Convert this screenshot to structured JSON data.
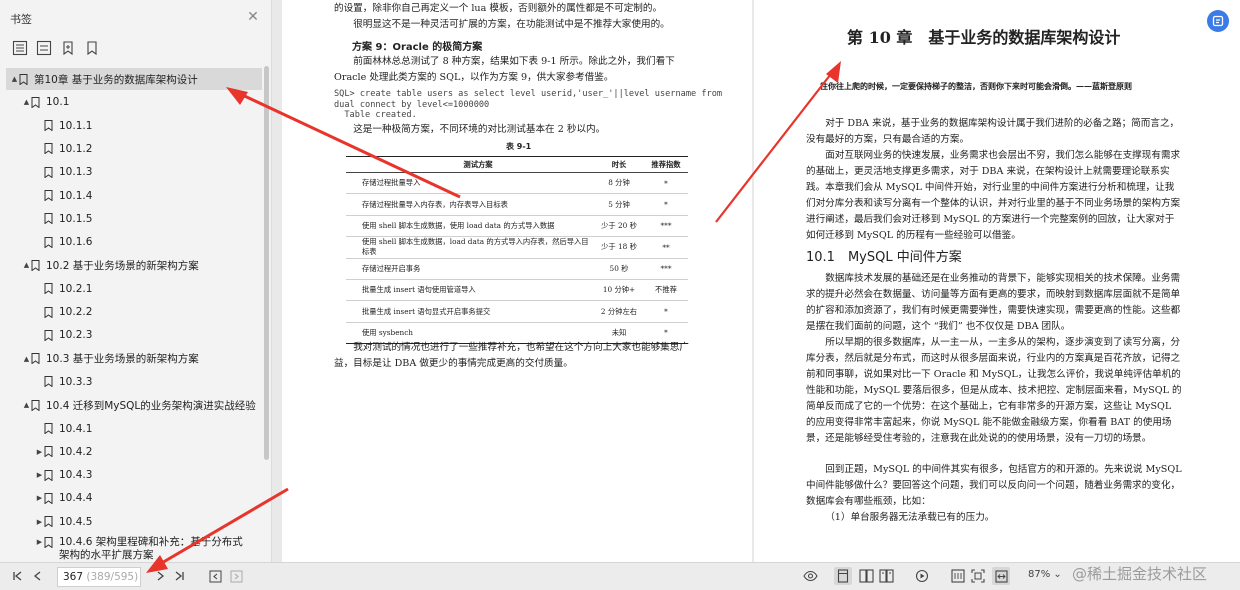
{
  "sidebar": {
    "title": "书签",
    "tools": [
      "expand-all-icon",
      "collapse-all-icon",
      "add-bookmark-icon",
      "bookmark-icon"
    ],
    "items": [
      {
        "label": "第10章 基于业务的数据库架构设计",
        "level": 1,
        "toggle": "▲",
        "selected": true
      },
      {
        "label": "10.1",
        "level": 2,
        "toggle": "▲"
      },
      {
        "label": "10.1.1",
        "level": 3,
        "toggle": ""
      },
      {
        "label": "10.1.2",
        "level": 3,
        "toggle": ""
      },
      {
        "label": "10.1.3",
        "level": 3,
        "toggle": ""
      },
      {
        "label": "10.1.4",
        "level": 3,
        "toggle": ""
      },
      {
        "label": "10.1.5",
        "level": 3,
        "toggle": ""
      },
      {
        "label": "10.1.6",
        "level": 3,
        "toggle": ""
      },
      {
        "label": "10.2 基于业务场景的新架构方案",
        "level": 2,
        "toggle": "▲"
      },
      {
        "label": "10.2.1",
        "level": 3,
        "toggle": ""
      },
      {
        "label": "10.2.2",
        "level": 3,
        "toggle": ""
      },
      {
        "label": "10.2.3",
        "level": 3,
        "toggle": ""
      },
      {
        "label": "10.3 基于业务场景的新架构方案",
        "level": 2,
        "toggle": "▲"
      },
      {
        "label": "10.3.3",
        "level": 3,
        "toggle": ""
      },
      {
        "label": "10.4 迁移到MySQL的业务架构演进实战经验",
        "level": 2,
        "toggle": "▲"
      },
      {
        "label": "10.4.1",
        "level": 3,
        "toggle": ""
      },
      {
        "label": "10.4.2",
        "level": 4,
        "toggle": "▶"
      },
      {
        "label": "10.4.3",
        "level": 4,
        "toggle": "▶"
      },
      {
        "label": "10.4.4",
        "level": 4,
        "toggle": "▶"
      },
      {
        "label": "10.4.5",
        "level": 4,
        "toggle": "▶"
      },
      {
        "label": "10.4.6 架构里程碑和补充：基于分布式架构的水平扩展方案",
        "level": 4,
        "toggle": "▶",
        "two_line": true
      }
    ]
  },
  "left_page": {
    "top_line_1": "的设置，除非你自己再定义一个 lua 模板，否则额外的属性都是不可定制的。",
    "top_line_2": "很明显这不是一种灵活可扩展的方案，在功能测试中是不推荐大家使用的。",
    "section": "方案 9：Oracle 的极简方案",
    "para_1": "前面林林总总测试了 8 种方案，结果如下表 9-1 所示。除此之外，我们看下 Oracle 处理此类方案的 SQL，以作为方案 9，供大家参考借鉴。",
    "code": "SQL> create table users as select level userid,'user_'||level username from\ndual connect by level<=1000000\n  Table created.",
    "para_2": "这是一种极简方案，不同环境的对比测试基本在 2 秒以内。",
    "table_caption": "表 9-1",
    "table_headers": [
      "测试方案",
      "时长",
      "推荐指数"
    ],
    "table_rows": [
      [
        "存储过程批量导入",
        "8 分钟",
        "*"
      ],
      [
        "存储过程批量导入内存表，内存表导入目标表",
        "5 分钟",
        "*"
      ],
      [
        "使用 shell 脚本生成数据，使用 load data 的方式导入数据",
        "少于 20 秒",
        "***"
      ],
      [
        "使用 shell 脚本生成数据，load data 的方式导入内存表，然后导入目标表",
        "少于 18 秒",
        "**"
      ],
      [
        "存储过程开启事务",
        "50 秒",
        "***"
      ],
      [
        "批量生成 insert 语句使用管道导入",
        "10 分钟+",
        "不推荐"
      ],
      [
        "批量生成 insert 语句显式开启事务提交",
        "2 分钟左右",
        "*"
      ],
      [
        "使用 sysbench",
        "未知",
        "*"
      ]
    ],
    "para_3": "我对测试的情况也进行了一些推荐补充，也希望在这个方向上大家也能够集思广益，目标是让 DBA 做更少的事情完成更高的交付质量。"
  },
  "right_page": {
    "chapter_title": "第 10 章　基于业务的数据库架构设计",
    "epigraph": "往你往上爬的时候，一定要保持梯子的整洁，否则你下来时可能会滑倒。——蓝斯登原则",
    "para_1": "对于 DBA 来说，基于业务的数据库架构设计属于我们进阶的必备之路；简而言之，没有最好的方案，只有最合适的方案。",
    "para_2": "面对互联网业务的快速发展，业务需求也会层出不穷，我们怎么能够在支撑现有需求的基础上，更灵活地支撑更多需求，对于 DBA 来说，在架构设计上就需要理论联系实践。本章我们会从 MySQL 中间件开始，对行业里的中间件方案进行分析和梳理，让我们对分库分表和读写分离有一个整体的认识，并对行业里的基于不同业务场景的架构方案进行阐述，最后我们会对迁移到 MySQL 的方案进行一个完整案例的回放，让大家对于如何迁移到 MySQL 的历程有一些经验可以借鉴。",
    "section_title": "10.1　MySQL 中间件方案",
    "para_3": "数据库技术发展的基础还是在业务推动的背景下，能够实现相关的技术保障。业务需求的提升必然会在数据量、访问量等方面有更高的要求，而映射到数据库层面就不是简单的扩容和添加资源了，我们有时候更需要弹性，需要快速实现，需要更高的性能。这些都是摆在我们面前的问题，这个 “我们” 也不仅仅是 DBA 团队。",
    "para_4": "所以早期的很多数据库，从一主一从，一主多从的架构，逐步演变到了读写分离，分库分表，然后就是分布式，而这时从很多层面来说，行业内的方案真是百花齐放，记得之前和同事聊，说如果对比一下 Oracle 和 MySQL，让我怎么评价，我说单纯评估单机的性能和功能，MySQL 要落后很多，但是从成本、技术把控、定制层面来看，MySQL 的简单反而成了它的一个优势：在这个基础上，它有非常多的开源方案，这些让 MySQL 的应用变得非常丰富起来，你说 MySQL 能不能做金融级方案，你看看 BAT 的使用场景，还是能够经受住考验的，注意我在此处说的的使用场景，没有一刀切的场景。",
    "para_5": "回到正题，MySQL 的中间件其实有很多，包括官方的和开源的。先来说说 MySQL 中间件能够做什么？要回答这个问题，我们可以反向问一个问题，随着业务需求的变化，数据库会有哪些瓶颈，比如：",
    "list_1": "（1）单台服务器无法承载已有的压力。"
  },
  "statusbar": {
    "current_page": "367",
    "page_total": "(389/595)",
    "zoom": "87%",
    "zoom_caret": "⌄"
  },
  "watermark": "@稀土掘金技术社区",
  "colors": {
    "accent": "#3b7be8",
    "arrow": "#e8342b",
    "selected": "#d9d9d9"
  }
}
